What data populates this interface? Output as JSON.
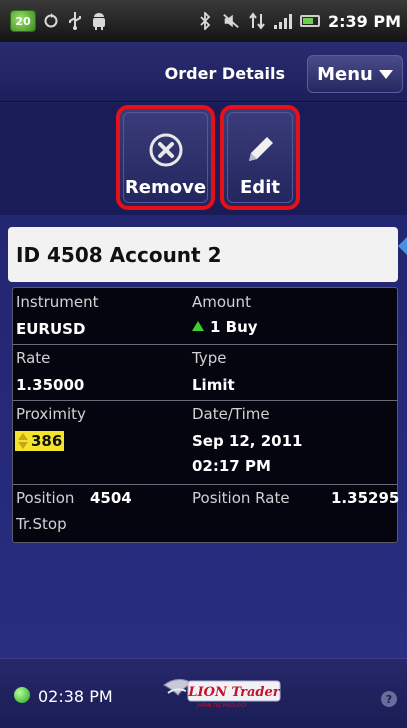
{
  "status_bar": {
    "notification_count": "20",
    "time": "2:39 PM",
    "icons": [
      "sync-icon",
      "usb-icon",
      "android-debug-icon",
      "bluetooth-icon",
      "silent-icon",
      "data-activity-icon",
      "signal-icon",
      "battery-icon"
    ]
  },
  "header": {
    "title": "Order Details",
    "menu_label": "Menu"
  },
  "toolbar": {
    "remove_label": "Remove",
    "edit_label": "Edit",
    "highlight_color": "#e4101a"
  },
  "order": {
    "heading": "ID 4508 Account 2",
    "instrument_label": "Instrument",
    "instrument_value": "EURUSD",
    "amount_label": "Amount",
    "amount_value": "1 Buy",
    "rate_label": "Rate",
    "rate_value": "1.35000",
    "type_label": "Type",
    "type_value": "Limit",
    "proximity_label": "Proximity",
    "proximity_value": "386",
    "datetime_label": "Date/Time",
    "date_value": "Sep 12, 2011",
    "time_value": "02:17 PM",
    "position_label": "Position",
    "position_value": "4504",
    "position_rate_label": "Position Rate",
    "position_rate_value": "1.35295",
    "trstop_label": "Tr.Stop"
  },
  "footer": {
    "connection_time": "02:38 PM",
    "logo_text": "LION Trader",
    "logo_subtext": "JAPAN TECHNOLOGY"
  }
}
